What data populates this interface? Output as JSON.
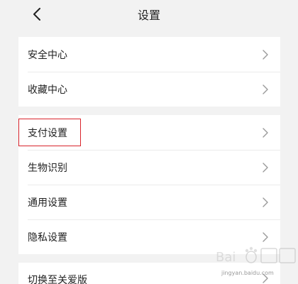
{
  "header": {
    "title": "设置",
    "back_icon": "chevron-left-icon"
  },
  "groups": [
    {
      "items": [
        {
          "label": "安全中心"
        },
        {
          "label": "收藏中心"
        }
      ]
    },
    {
      "items": [
        {
          "label": "支付设置",
          "highlighted": true
        },
        {
          "label": "生物识别"
        },
        {
          "label": "通用设置"
        },
        {
          "label": "隐私设置"
        }
      ]
    },
    {
      "items": [
        {
          "label": "切换至关爱版"
        }
      ]
    }
  ],
  "watermark": {
    "text": "jingyan.baidu.com"
  },
  "colors": {
    "background": "#f2f2f2",
    "card": "#ffffff",
    "highlight_border": "#d9232b",
    "chevron": "#999999"
  }
}
